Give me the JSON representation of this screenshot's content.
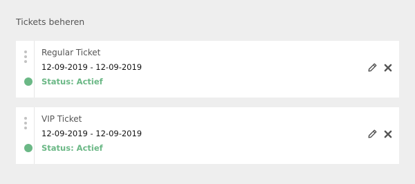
{
  "page": {
    "title": "Tickets beheren"
  },
  "tickets": [
    {
      "name": "Regular Ticket",
      "dates": "12-09-2019 - 12-09-2019",
      "status": "Status: Actief"
    },
    {
      "name": "VIP Ticket",
      "dates": "12-09-2019 - 12-09-2019",
      "status": "Status: Actief"
    }
  ],
  "colors": {
    "background": "#eeeeee",
    "card": "#ffffff",
    "status_active": "#6bb886",
    "icon": "#555555",
    "drag_handle": "#c2c2c2"
  },
  "icons": {
    "drag": "drag-handle-icon",
    "status": "status-dot-icon",
    "edit": "pencil-icon",
    "delete": "close-icon"
  }
}
